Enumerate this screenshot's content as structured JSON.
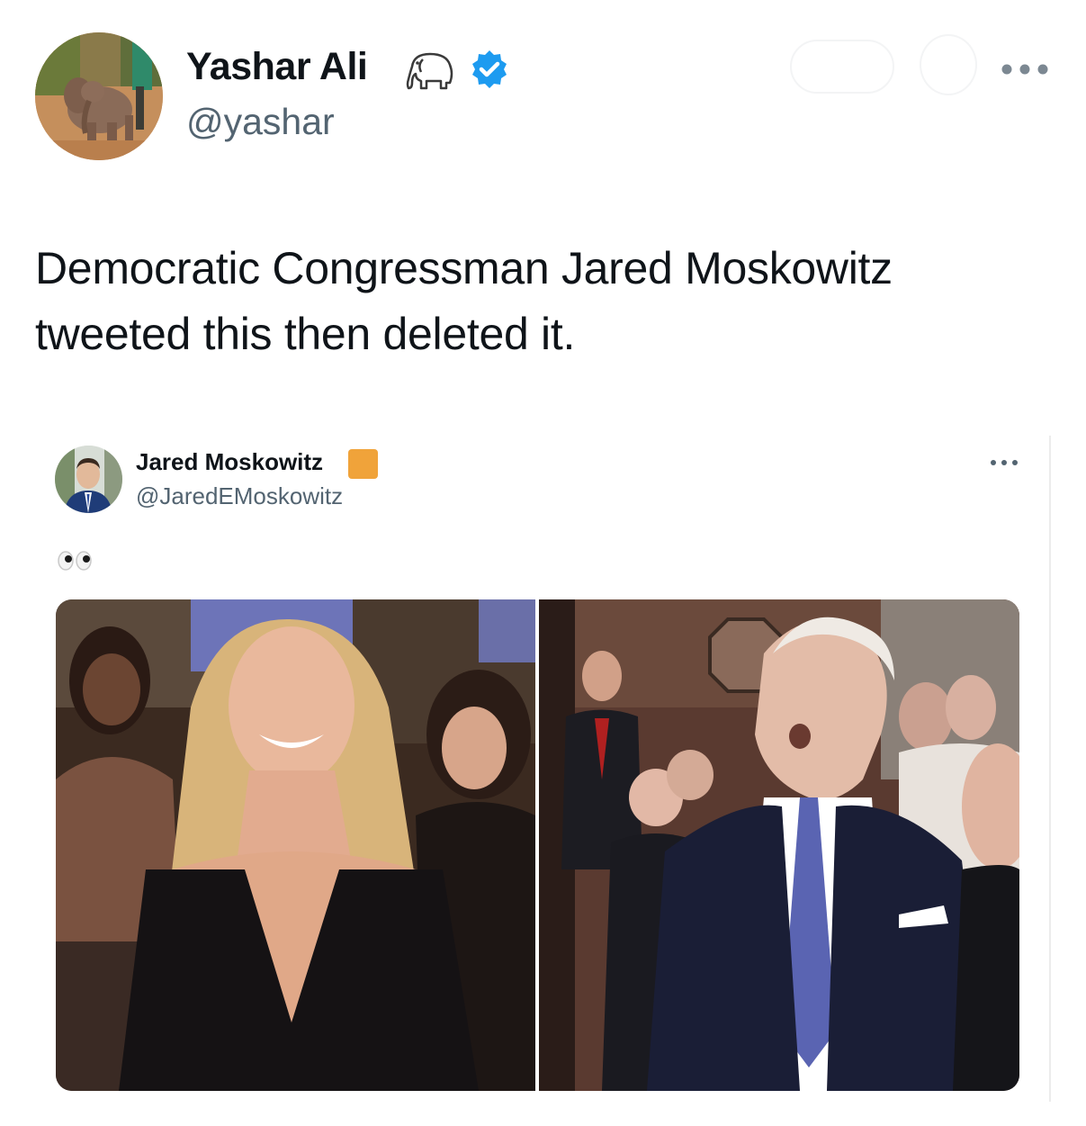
{
  "author": {
    "display_name": "Yashar Ali",
    "handle": "@yashar",
    "name_emoji": "elephant-icon",
    "verified": true,
    "verified_color": "#1d9bf0"
  },
  "tweet": {
    "text": "Democratic Congressman Jared Moskowitz tweeted this then deleted it."
  },
  "quoted_tweet": {
    "display_name": "Jared Moskowitz",
    "handle": "@JaredEMoskowitz",
    "badge_color": "#f0a33a",
    "text_emoji": "eyes-icon"
  },
  "colors": {
    "text_primary": "#0f1419",
    "text_secondary": "#536471"
  }
}
